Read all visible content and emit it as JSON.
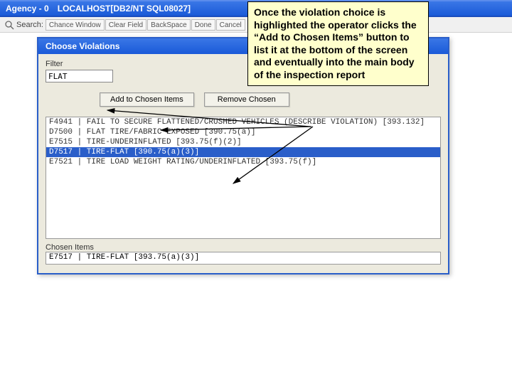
{
  "titlebar": {
    "agency": "Agency - 0",
    "connection": "LOCALHOST[DB2/NT SQL08027]"
  },
  "toolbar": {
    "search_label": "Search:",
    "buttons": [
      "Chance Window",
      "Clear Field",
      "BackSpace",
      "Done",
      "Cancel"
    ]
  },
  "dialog": {
    "title": "Choose Violations",
    "filter_label": "Filter",
    "filter_value": "FLAT",
    "add_btn": "Add to Chosen Items",
    "remove_btn": "Remove Chosen",
    "list": [
      {
        "text": "F4941 | FAIL TO SECURE FLATTENED/CRUSHED VEHICLES (DESCRIBE VIOLATION)   [393.132]",
        "selected": false
      },
      {
        "text": "D7500 | FLAT TIRE/FABRIC EXPOSED   [390.75(a)]",
        "selected": false
      },
      {
        "text": "E7515 | TIRE-UNDERINFLATED   [393.75(f)(2)]",
        "selected": false
      },
      {
        "text": "D7517 | TIRE-FLAT   [390.75(a)(3)]",
        "selected": true
      },
      {
        "text": "E7521 | TIRE LOAD WEIGHT RATING/UNDERINFLATED   [393.75(f)]",
        "selected": false
      }
    ],
    "chosen_label": "Chosen Items",
    "chosen_value": "E7517 | TIRE-FLAT   [393.75(a)(3)]"
  },
  "callout": {
    "text": "Once the violation choice is highlighted the operator clicks the “Add to Chosen Items” button to list it at the bottom of the screen and eventually into the main body of the inspection report"
  }
}
